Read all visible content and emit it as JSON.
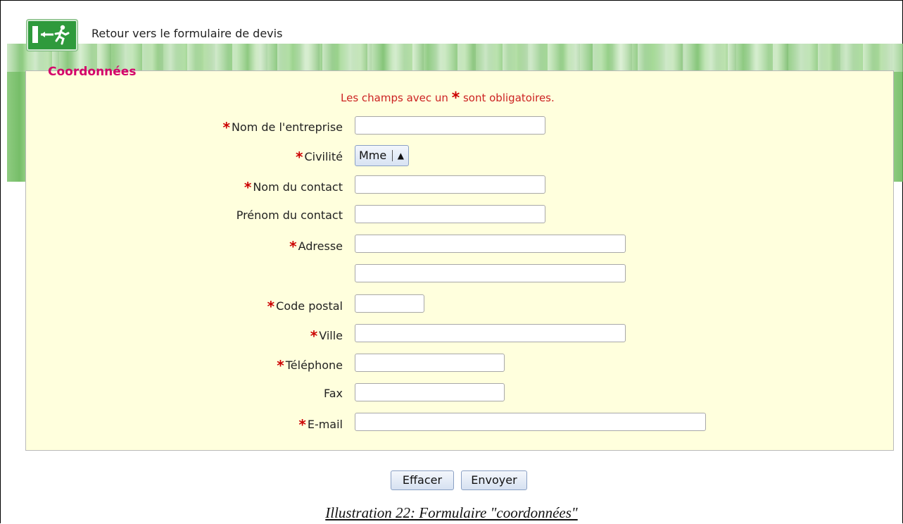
{
  "header": {
    "back_link": "Retour vers le formulaire de devis",
    "exit_icon": "exit-door-icon"
  },
  "form": {
    "legend": "Coordonnées",
    "notice_before": "Les champs avec un",
    "notice_star": "*",
    "notice_after": "sont obligatoires.",
    "fields": {
      "company": {
        "label": "Nom de l'entreprise",
        "required": true,
        "value": ""
      },
      "civility": {
        "label": "Civilité",
        "required": true,
        "value": "Mme"
      },
      "contact_name": {
        "label": "Nom du contact",
        "required": true,
        "value": ""
      },
      "contact_firstname": {
        "label": "Prénom du contact",
        "required": false,
        "value": ""
      },
      "address": {
        "label": "Adresse",
        "required": true,
        "value": "",
        "value2": ""
      },
      "postal_code": {
        "label": "Code postal",
        "required": true,
        "value": ""
      },
      "city": {
        "label": "Ville",
        "required": true,
        "value": ""
      },
      "phone": {
        "label": "Téléphone",
        "required": true,
        "value": ""
      },
      "fax": {
        "label": "Fax",
        "required": false,
        "value": ""
      },
      "email": {
        "label": "E-mail",
        "required": true,
        "value": ""
      }
    },
    "star": "*"
  },
  "buttons": {
    "clear": "Effacer",
    "send": "Envoyer"
  },
  "caption": "Illustration 22: Formulaire \"coordonnées\"",
  "colors": {
    "legend": "#d4006a",
    "required_star": "#cc0000",
    "fieldset_bg": "#ffffdd"
  }
}
